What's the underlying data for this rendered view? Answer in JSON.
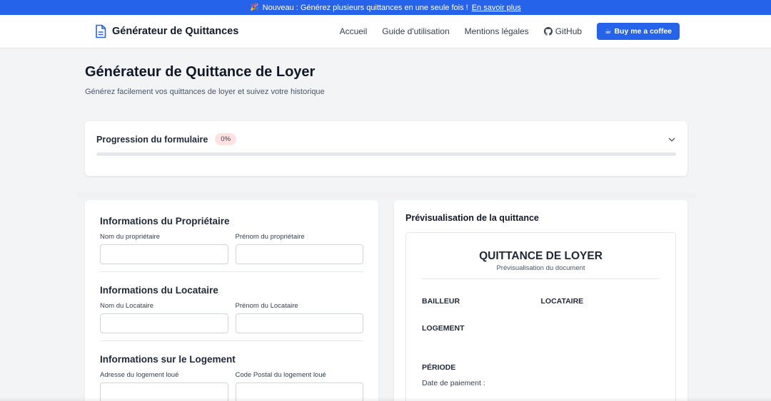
{
  "banner": {
    "icon": "party-popper-icon",
    "text": "Nouveau : Générez plusieurs quittances en une seule fois !",
    "link": "En savoir plus"
  },
  "navbar": {
    "brand": "Générateur de Quittances",
    "links": [
      "Accueil",
      "Guide d'utilisation",
      "Mentions légales"
    ],
    "github": "GitHub",
    "coffee": "Buy me a coffee"
  },
  "hero": {
    "title": "Générateur de Quittance de Loyer",
    "subtitle": "Générez facilement vos quittances de loyer et suivez votre historique"
  },
  "progress": {
    "title": "Progression du formulaire",
    "badge": "0%",
    "value": 0
  },
  "form": {
    "owner": {
      "title": "Informations du Propriétaire",
      "name_label": "Nom du propriétaire",
      "firstname_label": "Prénom du propriétaire",
      "name_value": "",
      "firstname_value": ""
    },
    "tenant": {
      "title": "Informations du Locataire",
      "name_label": "Nom du Locataire",
      "firstname_label": "Prénom du Locataire",
      "name_value": "",
      "firstname_value": ""
    },
    "housing": {
      "title": "Informations sur le Logement",
      "address_label": "Adresse du logement loué",
      "postal_label": "Code Postal du logement loué",
      "address_value": "",
      "postal_value": ""
    }
  },
  "preview": {
    "title": "Prévisualisation de la quittance",
    "doc_title": "QUITTANCE DE LOYER",
    "doc_subtitle": "Prévisualisation du document",
    "bailleur": "BAILLEUR",
    "locataire": "LOCATAIRE",
    "logement": "LOGEMENT",
    "periode": "PÉRIODE",
    "payment_date": "Date de paiement :"
  },
  "colors": {
    "accent": "#2563eb",
    "badge_bg": "#fee2e2",
    "page_bg": "#f3f4f6"
  }
}
